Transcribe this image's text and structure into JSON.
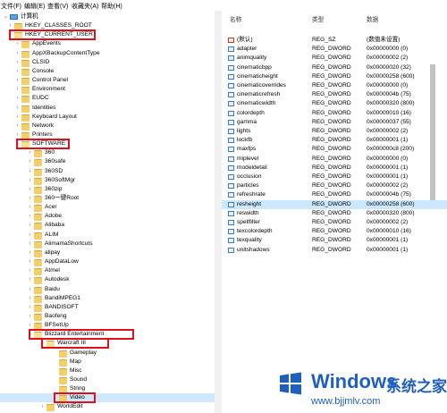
{
  "menu": [
    "文件(F)",
    "编辑(E)",
    "查看(V)",
    "收藏夹(A)",
    "帮助(H)"
  ],
  "tree": [
    {
      "label": "计算机",
      "depth": 0,
      "expanded": true,
      "icon": "computer"
    },
    {
      "label": "HKEY_CLASSES_ROOT",
      "depth": 1,
      "expanded": false
    },
    {
      "label": "HKEY_CURRENT_USER",
      "depth": 1,
      "expanded": true,
      "highlight": true
    },
    {
      "label": "AppEvents",
      "depth": 2
    },
    {
      "label": "AppXBackupContentType",
      "depth": 2
    },
    {
      "label": "CLSID",
      "depth": 2
    },
    {
      "label": "Console",
      "depth": 2
    },
    {
      "label": "Control Panel",
      "depth": 2
    },
    {
      "label": "Environment",
      "depth": 2
    },
    {
      "label": "EUDC",
      "depth": 2
    },
    {
      "label": "Identities",
      "depth": 2
    },
    {
      "label": "Keyboard Layout",
      "depth": 2
    },
    {
      "label": "Network",
      "depth": 2
    },
    {
      "label": "Printers",
      "depth": 2
    },
    {
      "label": "SOFTWARE",
      "depth": 2,
      "expanded": true,
      "highlight": true
    },
    {
      "label": "360",
      "depth": 3
    },
    {
      "label": "360safe",
      "depth": 3
    },
    {
      "label": "360SD",
      "depth": 3
    },
    {
      "label": "360SoftMgr",
      "depth": 3
    },
    {
      "label": "360zip",
      "depth": 3
    },
    {
      "label": "360一键Root",
      "depth": 3
    },
    {
      "label": "Acer",
      "depth": 3
    },
    {
      "label": "Adobe",
      "depth": 3
    },
    {
      "label": "Alibaba",
      "depth": 3
    },
    {
      "label": "ALIM",
      "depth": 3
    },
    {
      "label": "AlimamaShortcuts",
      "depth": 3
    },
    {
      "label": "alipay",
      "depth": 3
    },
    {
      "label": "AppDataLow",
      "depth": 3
    },
    {
      "label": "Atmel",
      "depth": 3
    },
    {
      "label": "Autodesk",
      "depth": 3
    },
    {
      "label": "Baidu",
      "depth": 3
    },
    {
      "label": "BandiMPEG1",
      "depth": 3
    },
    {
      "label": "BANDISOFT",
      "depth": 3
    },
    {
      "label": "Baofeng",
      "depth": 3
    },
    {
      "label": "BFSetUp",
      "depth": 3
    },
    {
      "label": "Blizzard Entertainment",
      "depth": 3,
      "expanded": true,
      "highlight": true
    },
    {
      "label": "Warcraft III",
      "depth": 4,
      "expanded": true,
      "highlight": true
    },
    {
      "label": "Gameplay",
      "depth": 5,
      "leaf": true
    },
    {
      "label": "Map",
      "depth": 5,
      "leaf": true
    },
    {
      "label": "Misc",
      "depth": 5,
      "leaf": true
    },
    {
      "label": "Sound",
      "depth": 5,
      "leaf": true
    },
    {
      "label": "String",
      "depth": 5,
      "leaf": true
    },
    {
      "label": "Video",
      "depth": 5,
      "leaf": true,
      "selected": true,
      "highlight": true
    },
    {
      "label": "WorldEdit",
      "depth": 4
    }
  ],
  "list": {
    "headers": {
      "name": "名称",
      "type": "类型",
      "data": "数据"
    },
    "rows": [
      {
        "name": "(默认)",
        "type": "REG_SZ",
        "data": "(数值未设置)",
        "kind": "sz"
      },
      {
        "name": "adapter",
        "type": "REG_DWORD",
        "data": "0x00000000 (0)"
      },
      {
        "name": "animquality",
        "type": "REG_DWORD",
        "data": "0x00000002 (2)"
      },
      {
        "name": "cinematicbpp",
        "type": "REG_DWORD",
        "data": "0x00000020 (32)"
      },
      {
        "name": "cinematicheight",
        "type": "REG_DWORD",
        "data": "0x00000258 (600)"
      },
      {
        "name": "cinematicoverrides",
        "type": "REG_DWORD",
        "data": "0x00000000 (0)"
      },
      {
        "name": "cinematicrefresh",
        "type": "REG_DWORD",
        "data": "0x0000004b (75)"
      },
      {
        "name": "cinematicwidth",
        "type": "REG_DWORD",
        "data": "0x00000320 (800)"
      },
      {
        "name": "colordepth",
        "type": "REG_DWORD",
        "data": "0x00000010 (16)"
      },
      {
        "name": "gamma",
        "type": "REG_DWORD",
        "data": "0x00000037 (55)"
      },
      {
        "name": "lights",
        "type": "REG_DWORD",
        "data": "0x00000002 (2)"
      },
      {
        "name": "lockfb",
        "type": "REG_DWORD",
        "data": "0x00000001 (1)"
      },
      {
        "name": "maxfps",
        "type": "REG_DWORD",
        "data": "0x000000c8 (200)"
      },
      {
        "name": "miplevel",
        "type": "REG_DWORD",
        "data": "0x00000000 (0)"
      },
      {
        "name": "modeldetail",
        "type": "REG_DWORD",
        "data": "0x00000001 (1)"
      },
      {
        "name": "occlusion",
        "type": "REG_DWORD",
        "data": "0x00000001 (1)"
      },
      {
        "name": "particles",
        "type": "REG_DWORD",
        "data": "0x00000002 (2)"
      },
      {
        "name": "refreshrate",
        "type": "REG_DWORD",
        "data": "0x0000004b (75)"
      },
      {
        "name": "resheight",
        "type": "REG_DWORD",
        "data": "0x00000258 (600)",
        "selected": true
      },
      {
        "name": "reswidth",
        "type": "REG_DWORD",
        "data": "0x00000320 (800)"
      },
      {
        "name": "spellfilter",
        "type": "REG_DWORD",
        "data": "0x00000002 (2)"
      },
      {
        "name": "texcolordepth",
        "type": "REG_DWORD",
        "data": "0x00000010 (16)"
      },
      {
        "name": "texquality",
        "type": "REG_DWORD",
        "data": "0x00000001 (1)"
      },
      {
        "name": "unitshadows",
        "type": "REG_DWORD",
        "data": "0x00000001 (1)"
      }
    ]
  },
  "watermark": {
    "brand": "Windows",
    "suffix": "系统之家",
    "url": "www.bjjmlv.com"
  }
}
